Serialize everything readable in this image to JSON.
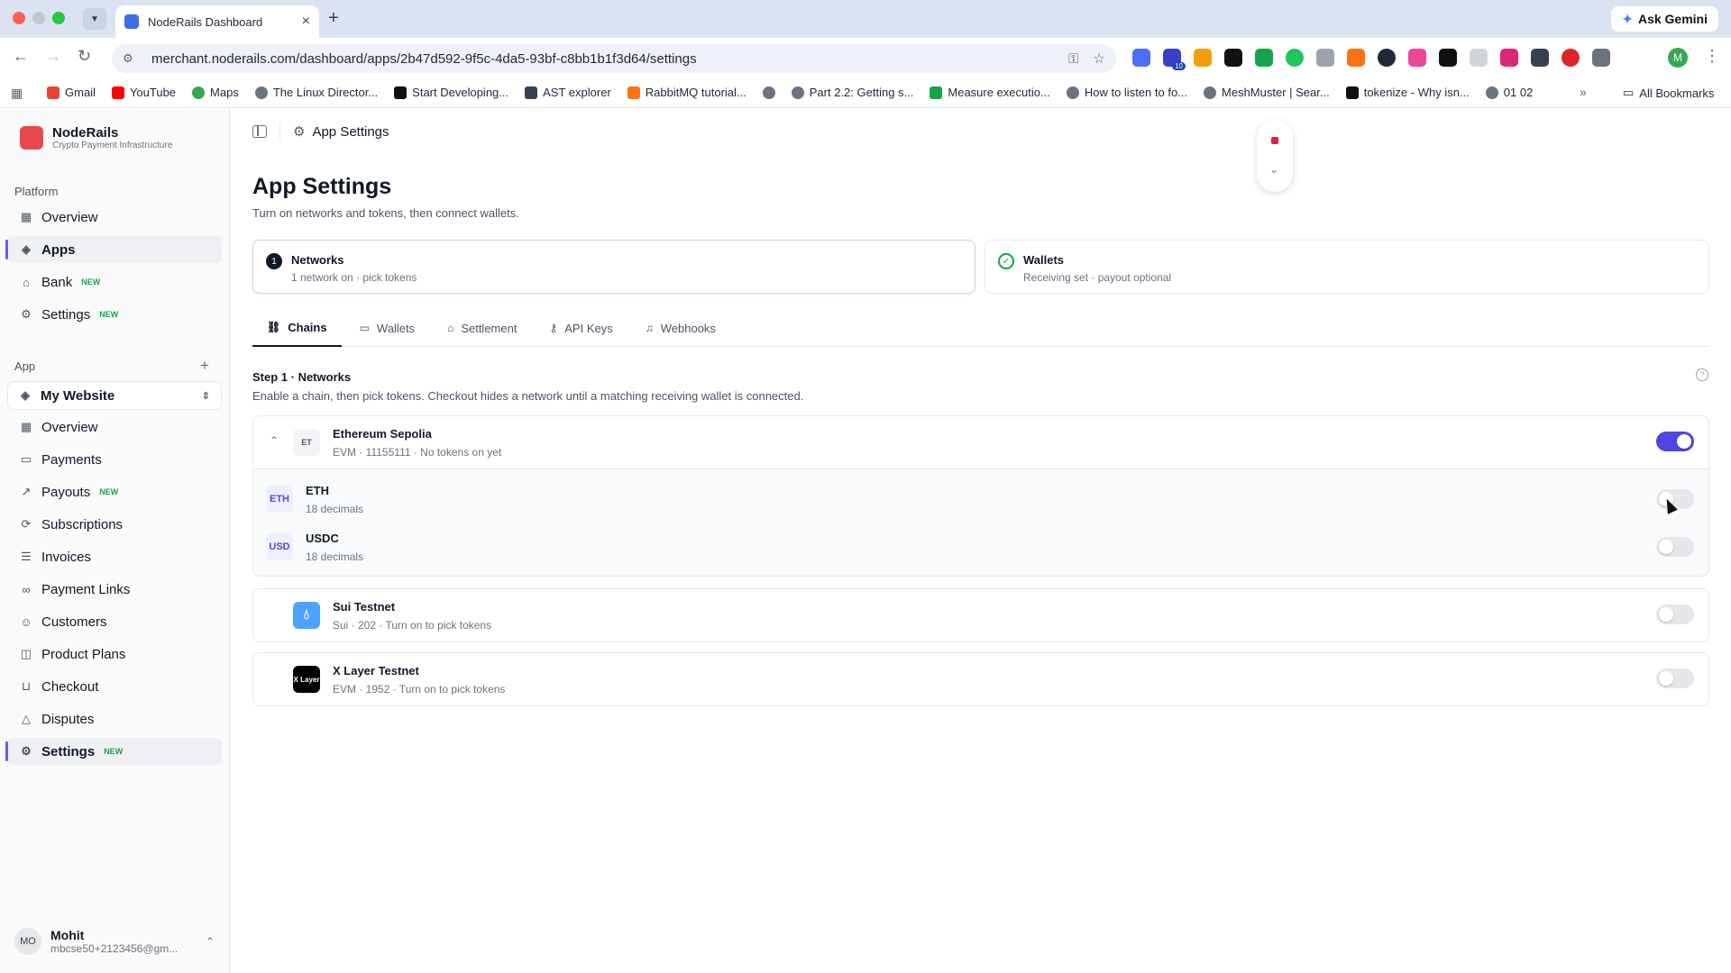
{
  "browser": {
    "tab_title": "NodeRails Dashboard",
    "url": "merchant.noderails.com/dashboard/apps/2b47d592-9f5c-4da5-93bf-c8bb1b1f3d64/settings",
    "ask_gemini": "Ask Gemini",
    "profile_initial": "M",
    "bookmarks": [
      "Gmail",
      "YouTube",
      "Maps",
      "The Linux Director...",
      "Start Developing...",
      "AST explorer",
      "RabbitMQ tutorial...",
      "",
      "Part 2.2: Getting s...",
      "Measure executio...",
      "How to listen to fo...",
      "MeshMuster | Sear...",
      "tokenize - Why isn...",
      "01 02"
    ],
    "all_bookmarks": "All Bookmarks",
    "extension_badge": "10"
  },
  "sidebar": {
    "brand_name": "NodeRails",
    "brand_sub": "Crypto Payment Infrastructure",
    "platform_label": "Platform",
    "platform_items": [
      {
        "label": "Overview",
        "icon": "grid-icon"
      },
      {
        "label": "Apps",
        "icon": "layers-icon"
      },
      {
        "label": "Bank",
        "icon": "bank-icon",
        "badge": "NEW"
      },
      {
        "label": "Settings",
        "icon": "gear-icon",
        "badge": "NEW"
      }
    ],
    "app_label": "App",
    "app_selected": "My Website",
    "app_items": [
      {
        "label": "Overview"
      },
      {
        "label": "Payments"
      },
      {
        "label": "Payouts",
        "badge": "NEW"
      },
      {
        "label": "Subscriptions"
      },
      {
        "label": "Invoices"
      },
      {
        "label": "Payment Links"
      },
      {
        "label": "Customers"
      },
      {
        "label": "Product Plans"
      },
      {
        "label": "Checkout"
      },
      {
        "label": "Disputes"
      },
      {
        "label": "Settings",
        "badge": "NEW"
      }
    ],
    "user": {
      "initials": "MO",
      "name": "Mohit",
      "email": "mbcse50+2123456@gm..."
    }
  },
  "main": {
    "breadcrumb": "App Settings",
    "title": "App Settings",
    "subtitle": "Turn on networks and tokens, then connect wallets.",
    "steps": [
      {
        "num": "1",
        "title": "Networks",
        "sub": "1 network on · pick tokens"
      },
      {
        "title": "Wallets",
        "sub": "Receiving set · payout optional"
      }
    ],
    "tabs": [
      "Chains",
      "Wallets",
      "Settlement",
      "API Keys",
      "Webhooks"
    ],
    "step_heading": "Step 1 · Networks",
    "step_desc": "Enable a chain, then pick tokens. Checkout hides a network until a matching receiving wallet is connected.",
    "chains": [
      {
        "logo": "ET",
        "name": "Ethereum Sepolia",
        "meta": "EVM · 11155111 · No tokens on yet",
        "enabled": true,
        "tokens": [
          {
            "logo": "ETH",
            "name": "ETH",
            "decimals": "18 decimals",
            "enabled": false
          },
          {
            "logo": "USD",
            "name": "USDC",
            "decimals": "18 decimals",
            "enabled": false
          }
        ]
      },
      {
        "logo": "",
        "name": "Sui Testnet",
        "meta": "Sui · 202 · Turn on to pick tokens",
        "enabled": false
      },
      {
        "logo": "X Layer",
        "name": "X Layer Testnet",
        "meta": "EVM · 1952 · Turn on to pick tokens",
        "enabled": false
      }
    ]
  }
}
